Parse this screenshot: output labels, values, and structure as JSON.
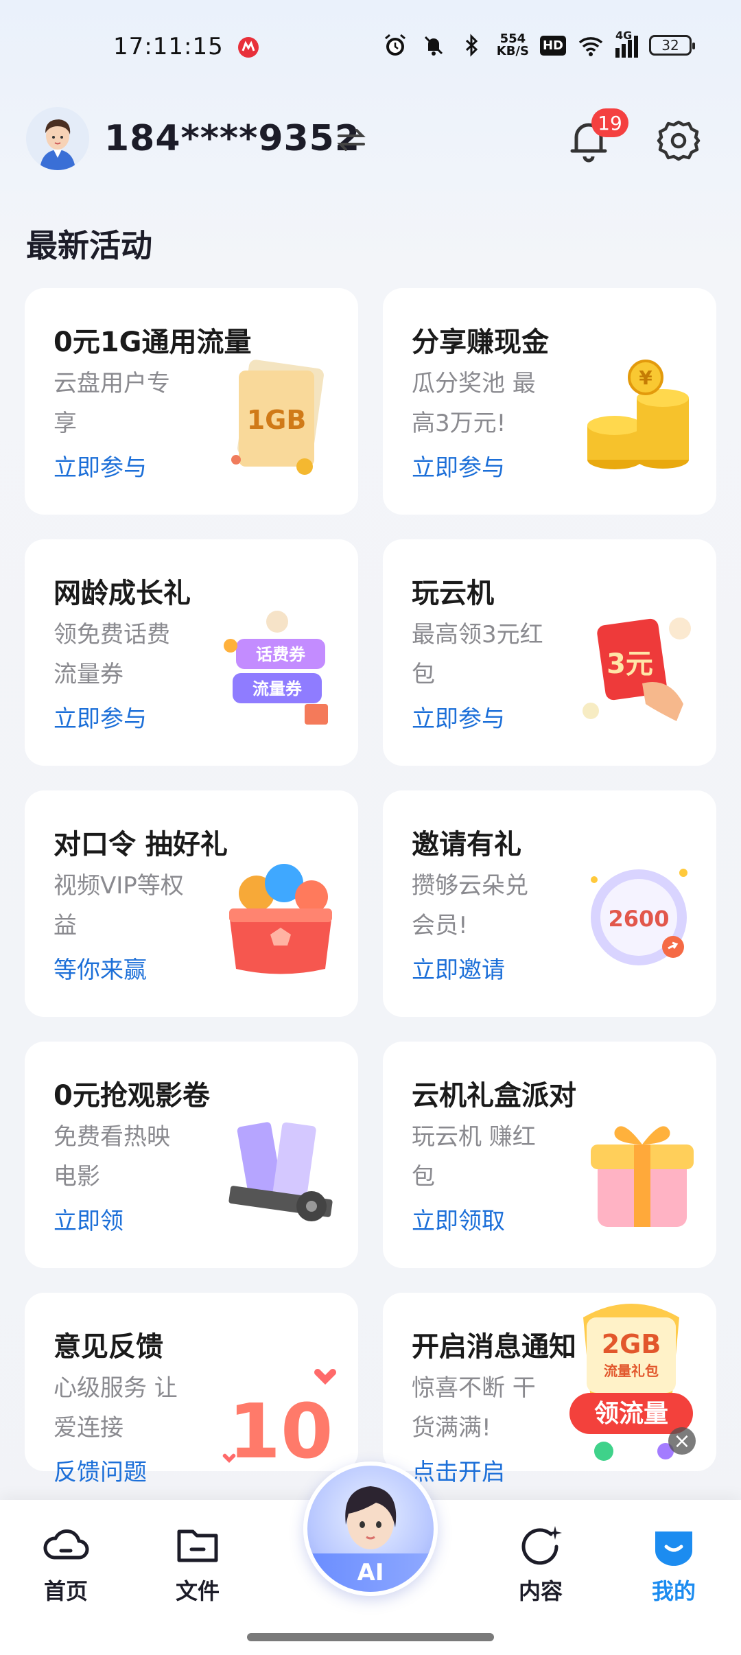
{
  "status": {
    "time": "17:11:15",
    "net_speed_value": "554",
    "net_speed_unit": "KB/S",
    "hd": "HD",
    "network": "4G",
    "battery": "32"
  },
  "header": {
    "phone": "184****9352",
    "notification_count": "19"
  },
  "section_title": "最新活动",
  "cards": [
    {
      "title": "0元1G通用流量",
      "desc": "云盘用户专享",
      "action": "立即参与",
      "art_text": "1GB"
    },
    {
      "title": "分享赚现金",
      "desc": "瓜分奖池 最高3万元!",
      "action": "立即参与",
      "art_text": "¥"
    },
    {
      "title": "网龄成长礼",
      "desc": "领免费话费流量券",
      "action": "立即参与",
      "art_text_1": "话费券",
      "art_text_2": "流量券"
    },
    {
      "title": "玩云机",
      "desc": "最高领3元红包",
      "action": "立即参与",
      "art_text": "3元"
    },
    {
      "title": "对口令 抽好礼",
      "desc": "视频VIP等权益",
      "action": "等你来赢",
      "art_text": ""
    },
    {
      "title": "邀请有礼",
      "desc": "攒够云朵兑会员!",
      "action": "立即邀请",
      "art_text": "2600"
    },
    {
      "title": "0元抢观影卷",
      "desc": "免费看热映电影",
      "action": "立即领",
      "art_text": ""
    },
    {
      "title": "云机礼盒派对",
      "desc": "玩云机 赚红包",
      "action": "立即领取",
      "art_text": ""
    },
    {
      "title": "意见反馈",
      "desc": "心级服务 让爱连接",
      "action": "反馈问题",
      "art_text": "10"
    },
    {
      "title": "开启消息通知",
      "desc": "惊喜不断 干货满满!",
      "action": "点击开启",
      "art_text": ""
    }
  ],
  "float_promo": {
    "size": "2GB",
    "subtitle": "流量礼包",
    "button": "领流量"
  },
  "tabs": [
    {
      "label": "首页",
      "icon": "cloud-icon"
    },
    {
      "label": "文件",
      "icon": "folder-icon"
    },
    {
      "label": "AI",
      "icon": "ai-avatar"
    },
    {
      "label": "内容",
      "icon": "sparkle-circle-icon"
    },
    {
      "label": "我的",
      "icon": "profile-icon",
      "active": true
    }
  ],
  "colors": {
    "accent": "#1c6fd8",
    "badge": "#f44040",
    "active_tab": "#1c8cf0"
  }
}
